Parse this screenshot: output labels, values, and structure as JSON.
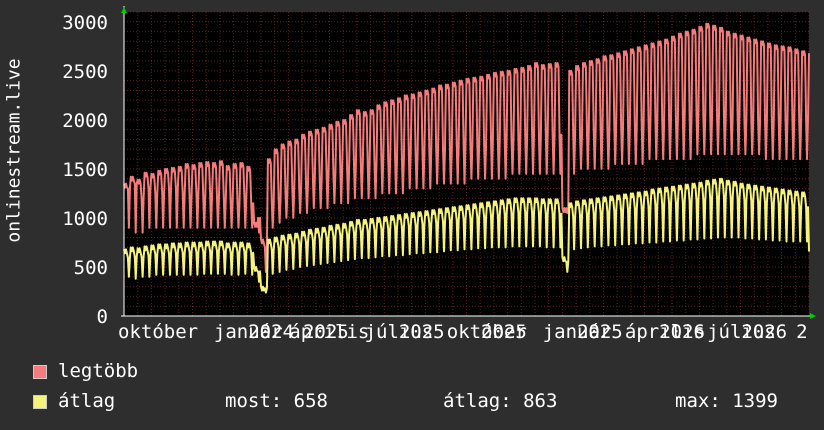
{
  "chart_data": {
    "type": "line",
    "title": "",
    "ylabel": "onlinestream.live",
    "xlabel": "",
    "ylim": [
      0,
      3100
    ],
    "yticks": [
      0,
      500,
      1000,
      1500,
      2000,
      2500,
      3000
    ],
    "xlim": [
      0,
      100
    ],
    "xticks": [
      {
        "x": 0,
        "label": "október"
      },
      {
        "x": 14,
        "label": "január"
      },
      {
        "x": 19,
        "label": "2024"
      },
      {
        "x": 25,
        "label": "április"
      },
      {
        "x": 27,
        "label": "2025"
      },
      {
        "x": 36,
        "label": "július"
      },
      {
        "x": 41,
        "label": "2025"
      },
      {
        "x": 48,
        "label": "október"
      },
      {
        "x": 53,
        "label": "2025"
      },
      {
        "x": 62,
        "label": "január"
      },
      {
        "x": 67,
        "label": "2025"
      },
      {
        "x": 74,
        "label": "április"
      },
      {
        "x": 79,
        "label": "2026"
      },
      {
        "x": 86,
        "label": "július"
      },
      {
        "x": 91,
        "label": "2026"
      },
      {
        "x": 99,
        "label": "2"
      }
    ],
    "grid": true,
    "background": "#000000",
    "series": [
      {
        "name": "legtöbb",
        "color": "#f47c7c",
        "x": [
          0,
          1,
          2,
          3,
          4,
          5,
          6,
          7,
          8,
          9,
          10,
          11,
          12,
          13,
          14,
          15,
          16,
          17,
          18,
          19,
          20,
          21,
          22,
          23,
          24,
          25,
          26,
          27,
          28,
          29,
          30,
          31,
          32,
          33,
          34,
          35,
          36,
          37,
          38,
          39,
          40,
          41,
          42,
          43,
          44,
          45,
          46,
          47,
          48,
          49,
          50,
          51,
          52,
          53,
          54,
          55,
          56,
          57,
          58,
          59,
          60,
          61,
          62,
          63,
          64,
          65,
          66,
          67,
          68,
          69,
          70,
          71,
          72,
          73,
          74,
          75,
          76,
          77,
          78,
          79,
          80,
          81,
          82,
          83,
          84,
          85,
          86,
          87,
          88,
          89,
          90,
          91,
          92,
          93,
          94,
          95,
          96,
          97,
          98,
          99,
          100
        ],
        "values": [
          1350,
          1420,
          1390,
          1460,
          1450,
          1480,
          1500,
          1510,
          1520,
          1550,
          1540,
          1560,
          1570,
          1560,
          1580,
          1530,
          1550,
          1560,
          1520,
          950,
          780,
          1600,
          1700,
          1750,
          1780,
          1800,
          1850,
          1880,
          1900,
          1920,
          1950,
          1980,
          2000,
          2050,
          2100,
          2080,
          2100,
          2150,
          2180,
          2200,
          2220,
          2250,
          2260,
          2280,
          2300,
          2320,
          2350,
          2360,
          2380,
          2400,
          2420,
          2430,
          2440,
          2460,
          2480,
          2490,
          2500,
          2520,
          2530,
          2550,
          2580,
          2560,
          2570,
          2580,
          1100,
          2500,
          2550,
          2580,
          2600,
          2620,
          2650,
          2660,
          2680,
          2700,
          2720,
          2740,
          2760,
          2780,
          2800,
          2820,
          2850,
          2880,
          2900,
          2920,
          2950,
          2980,
          2960,
          2940,
          2900,
          2880,
          2860,
          2840,
          2820,
          2800,
          2780,
          2760,
          2750,
          2740,
          2720,
          2700,
          2680
        ],
        "dips": [
          1300,
          1350,
          1200,
          1300,
          1250,
          1250,
          1300,
          1300,
          1250,
          1200,
          1250,
          1200,
          1250,
          1200,
          1200,
          1150,
          1150,
          1200,
          1150,
          1000,
          700,
          1150,
          1200,
          1250,
          1300,
          1300,
          1350,
          1400,
          1400,
          1450,
          1450,
          1500,
          1500,
          1550,
          1550,
          1550,
          1550,
          1600,
          1600,
          1600,
          1600,
          1650,
          1650,
          1650,
          1700,
          1700,
          1700,
          1700,
          1750,
          1750,
          1750,
          1750,
          1750,
          1800,
          1800,
          1800,
          1800,
          1800,
          1850,
          1850,
          1850,
          1850,
          1850,
          1850,
          1100,
          1850,
          1850,
          1900,
          1900,
          1900,
          1900,
          1950,
          1950,
          1950,
          1950,
          1950,
          2000,
          2000,
          2000,
          2000,
          2000,
          2050,
          2050,
          2050,
          2050,
          2050,
          2050,
          2050,
          2050,
          2050,
          2000,
          2000,
          2000,
          2000,
          2000,
          2000,
          2000,
          2000,
          2000,
          2000,
          1500
        ],
        "lows": [
          900,
          850,
          850,
          900,
          900,
          900,
          900,
          900,
          900,
          900,
          900,
          900,
          900,
          900,
          900,
          900,
          900,
          900,
          900,
          850,
          450,
          900,
          950,
          1000,
          1000,
          1050,
          1050,
          1100,
          1100,
          1100,
          1150,
          1150,
          1150,
          1200,
          1200,
          1200,
          1200,
          1250,
          1250,
          1250,
          1250,
          1300,
          1300,
          1300,
          1300,
          1350,
          1350,
          1350,
          1350,
          1350,
          1400,
          1400,
          1400,
          1400,
          1400,
          1400,
          1450,
          1450,
          1450,
          1450,
          1450,
          1450,
          1450,
          1450,
          1050,
          1450,
          1500,
          1500,
          1500,
          1500,
          1500,
          1550,
          1550,
          1550,
          1550,
          1550,
          1600,
          1600,
          1600,
          1600,
          1600,
          1600,
          1600,
          1650,
          1650,
          1650,
          1650,
          1650,
          1650,
          1650,
          1650,
          1650,
          1650,
          1600,
          1600,
          1600,
          1600,
          1600,
          1600,
          1600,
          1500
        ]
      },
      {
        "name": "átlag",
        "color": "#f4f47c",
        "x": [
          0,
          1,
          2,
          3,
          4,
          5,
          6,
          7,
          8,
          9,
          10,
          11,
          12,
          13,
          14,
          15,
          16,
          17,
          18,
          19,
          20,
          21,
          22,
          23,
          24,
          25,
          26,
          27,
          28,
          29,
          30,
          31,
          32,
          33,
          34,
          35,
          36,
          37,
          38,
          39,
          40,
          41,
          42,
          43,
          44,
          45,
          46,
          47,
          48,
          49,
          50,
          51,
          52,
          53,
          54,
          55,
          56,
          57,
          58,
          59,
          60,
          61,
          62,
          63,
          64,
          65,
          66,
          67,
          68,
          69,
          70,
          71,
          72,
          73,
          74,
          75,
          76,
          77,
          78,
          79,
          80,
          81,
          82,
          83,
          84,
          85,
          86,
          87,
          88,
          89,
          90,
          91,
          92,
          93,
          94,
          95,
          96,
          97,
          98,
          99,
          100
        ],
        "values": [
          680,
          700,
          690,
          710,
          720,
          730,
          730,
          740,
          740,
          750,
          750,
          750,
          760,
          760,
          760,
          740,
          750,
          750,
          740,
          500,
          300,
          780,
          800,
          820,
          830,
          840,
          860,
          880,
          890,
          900,
          920,
          930,
          940,
          960,
          980,
          980,
          990,
          1000,
          1010,
          1020,
          1030,
          1040,
          1050,
          1060,
          1070,
          1080,
          1090,
          1100,
          1110,
          1120,
          1130,
          1140,
          1150,
          1160,
          1170,
          1180,
          1190,
          1200,
          1200,
          1200,
          1200,
          1190,
          1190,
          1190,
          600,
          1150,
          1170,
          1180,
          1190,
          1200,
          1210,
          1220,
          1230,
          1240,
          1250,
          1260,
          1270,
          1290,
          1300,
          1310,
          1320,
          1330,
          1340,
          1350,
          1360,
          1380,
          1390,
          1399,
          1380,
          1370,
          1350,
          1340,
          1330,
          1320,
          1310,
          1300,
          1290,
          1280,
          1270,
          1260,
          658
        ],
        "lows": [
          400,
          380,
          400,
          400,
          420,
          420,
          420,
          420,
          420,
          420,
          420,
          430,
          430,
          430,
          430,
          420,
          420,
          430,
          420,
          350,
          240,
          430,
          450,
          470,
          480,
          500,
          510,
          520,
          530,
          540,
          550,
          560,
          570,
          580,
          590,
          590,
          600,
          610,
          610,
          620,
          620,
          630,
          640,
          640,
          650,
          650,
          660,
          670,
          670,
          680,
          680,
          690,
          690,
          700,
          700,
          700,
          710,
          710,
          710,
          710,
          710,
          700,
          700,
          700,
          450,
          680,
          690,
          700,
          710,
          710,
          720,
          720,
          730,
          730,
          740,
          740,
          750,
          750,
          760,
          760,
          770,
          770,
          780,
          780,
          790,
          790,
          800,
          800,
          800,
          800,
          790,
          790,
          780,
          780,
          770,
          770,
          760,
          760,
          760,
          760,
          658
        ]
      }
    ]
  },
  "legend": {
    "items": [
      {
        "name": "legtöbb",
        "color": "#f47c7c"
      },
      {
        "name": "átlag",
        "color": "#f4f47c"
      }
    ],
    "stats": {
      "most": "most: 658",
      "atlag": "átlag: 863",
      "max": "max: 1399"
    }
  },
  "colors": {
    "background": "#2e2e2e",
    "plot_bg": "#000000",
    "grid": "#5a2020",
    "axis": "#ffffff",
    "arrow": "#00cc00"
  }
}
